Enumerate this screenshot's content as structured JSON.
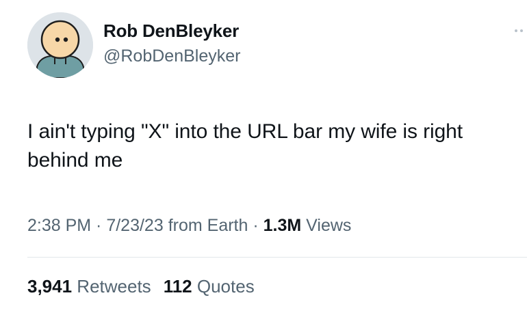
{
  "author": {
    "name": "Rob DenBleyker",
    "handle": "@RobDenBleyker"
  },
  "tweet": {
    "text": "I ain't typing \"X\" into the URL bar my wife is right behind me"
  },
  "meta": {
    "time": "2:38 PM",
    "sep1": " · ",
    "date": "7/23/23",
    "source": " from Earth",
    "sep2": " · ",
    "views_count": "1.3M",
    "views_label": " Views"
  },
  "stats": {
    "retweets_count": "3,941",
    "retweets_label": " Retweets",
    "quotes_count": "112",
    "quotes_label": " Quotes"
  },
  "colors": {
    "text": "#0f1419",
    "secondary": "#536471",
    "avatar_bg": "#dde3e8",
    "divider": "#e1e6ea"
  },
  "icons": {
    "more": "more-dots-icon",
    "avatar": "cartoon-face-avatar"
  }
}
